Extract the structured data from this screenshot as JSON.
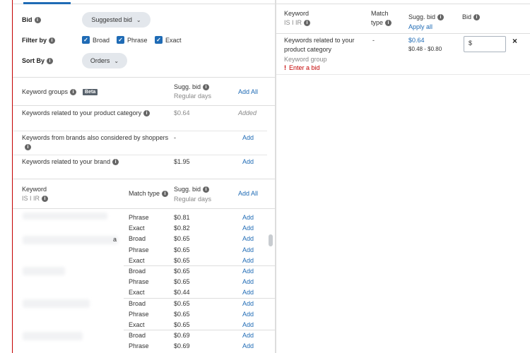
{
  "controls": {
    "bid_label": "Bid",
    "bid_value": "Suggested bid",
    "filter_label": "Filter by",
    "filters": [
      {
        "label": "Broad",
        "checked": true
      },
      {
        "label": "Phrase",
        "checked": true
      },
      {
        "label": "Exact",
        "checked": true
      }
    ],
    "sort_label": "Sort By",
    "sort_value": "Orders"
  },
  "groups": {
    "header_label": "Keyword groups",
    "beta": "Beta",
    "sugg_bid": "Sugg. bid",
    "regular_days": "Regular days",
    "add_all": "Add All",
    "rows": [
      {
        "name": "Keywords related to your product category",
        "bid": "$0.64",
        "action": "Added"
      },
      {
        "name": "Keywords from brands also considered by shoppers",
        "bid": "-",
        "action": "Add"
      },
      {
        "name": "Keywords related to your brand",
        "bid": "$1.95",
        "action": "Add"
      }
    ]
  },
  "keywords": {
    "col_keyword": "Keyword",
    "col_isir": "IS I IR",
    "col_match": "Match type",
    "sugg_bid": "Sugg. bid",
    "regular_days": "Regular days",
    "add_all": "Add All",
    "partial_char": "a",
    "rows": [
      {
        "match": "Phrase",
        "bid": "$0.81",
        "action": "Add"
      },
      {
        "match": "Exact",
        "bid": "$0.82",
        "action": "Add"
      },
      {
        "match": "Broad",
        "bid": "$0.65",
        "action": "Add"
      },
      {
        "match": "Phrase",
        "bid": "$0.65",
        "action": "Add"
      },
      {
        "match": "Exact",
        "bid": "$0.65",
        "action": "Add"
      },
      {
        "match": "Broad",
        "bid": "$0.65",
        "action": "Add"
      },
      {
        "match": "Phrase",
        "bid": "$0.65",
        "action": "Add"
      },
      {
        "match": "Exact",
        "bid": "$0.44",
        "action": "Add"
      },
      {
        "match": "Broad",
        "bid": "$0.65",
        "action": "Add"
      },
      {
        "match": "Phrase",
        "bid": "$0.65",
        "action": "Add"
      },
      {
        "match": "Exact",
        "bid": "$0.65",
        "action": "Add"
      },
      {
        "match": "Broad",
        "bid": "$0.69",
        "action": "Add"
      },
      {
        "match": "Phrase",
        "bid": "$0.69",
        "action": "Add"
      }
    ]
  },
  "added": {
    "col_keyword": "Keyword",
    "col_isir": "IS I IR",
    "col_match_1": "Match",
    "col_match_2": "type",
    "col_sugg": "Sugg. bid",
    "apply_all": "Apply all",
    "col_bid": "Bid",
    "row": {
      "name_1": "Keywords related to your",
      "name_2": "product category",
      "group": "Keyword group",
      "error": "Enter a bid",
      "match": "-",
      "bid": "$0.64",
      "range": "$0.48 - $0.80",
      "input_value": "$",
      "remove": "×"
    }
  },
  "colors": {
    "accent": "#1f6bb5",
    "error": "#c40000"
  }
}
